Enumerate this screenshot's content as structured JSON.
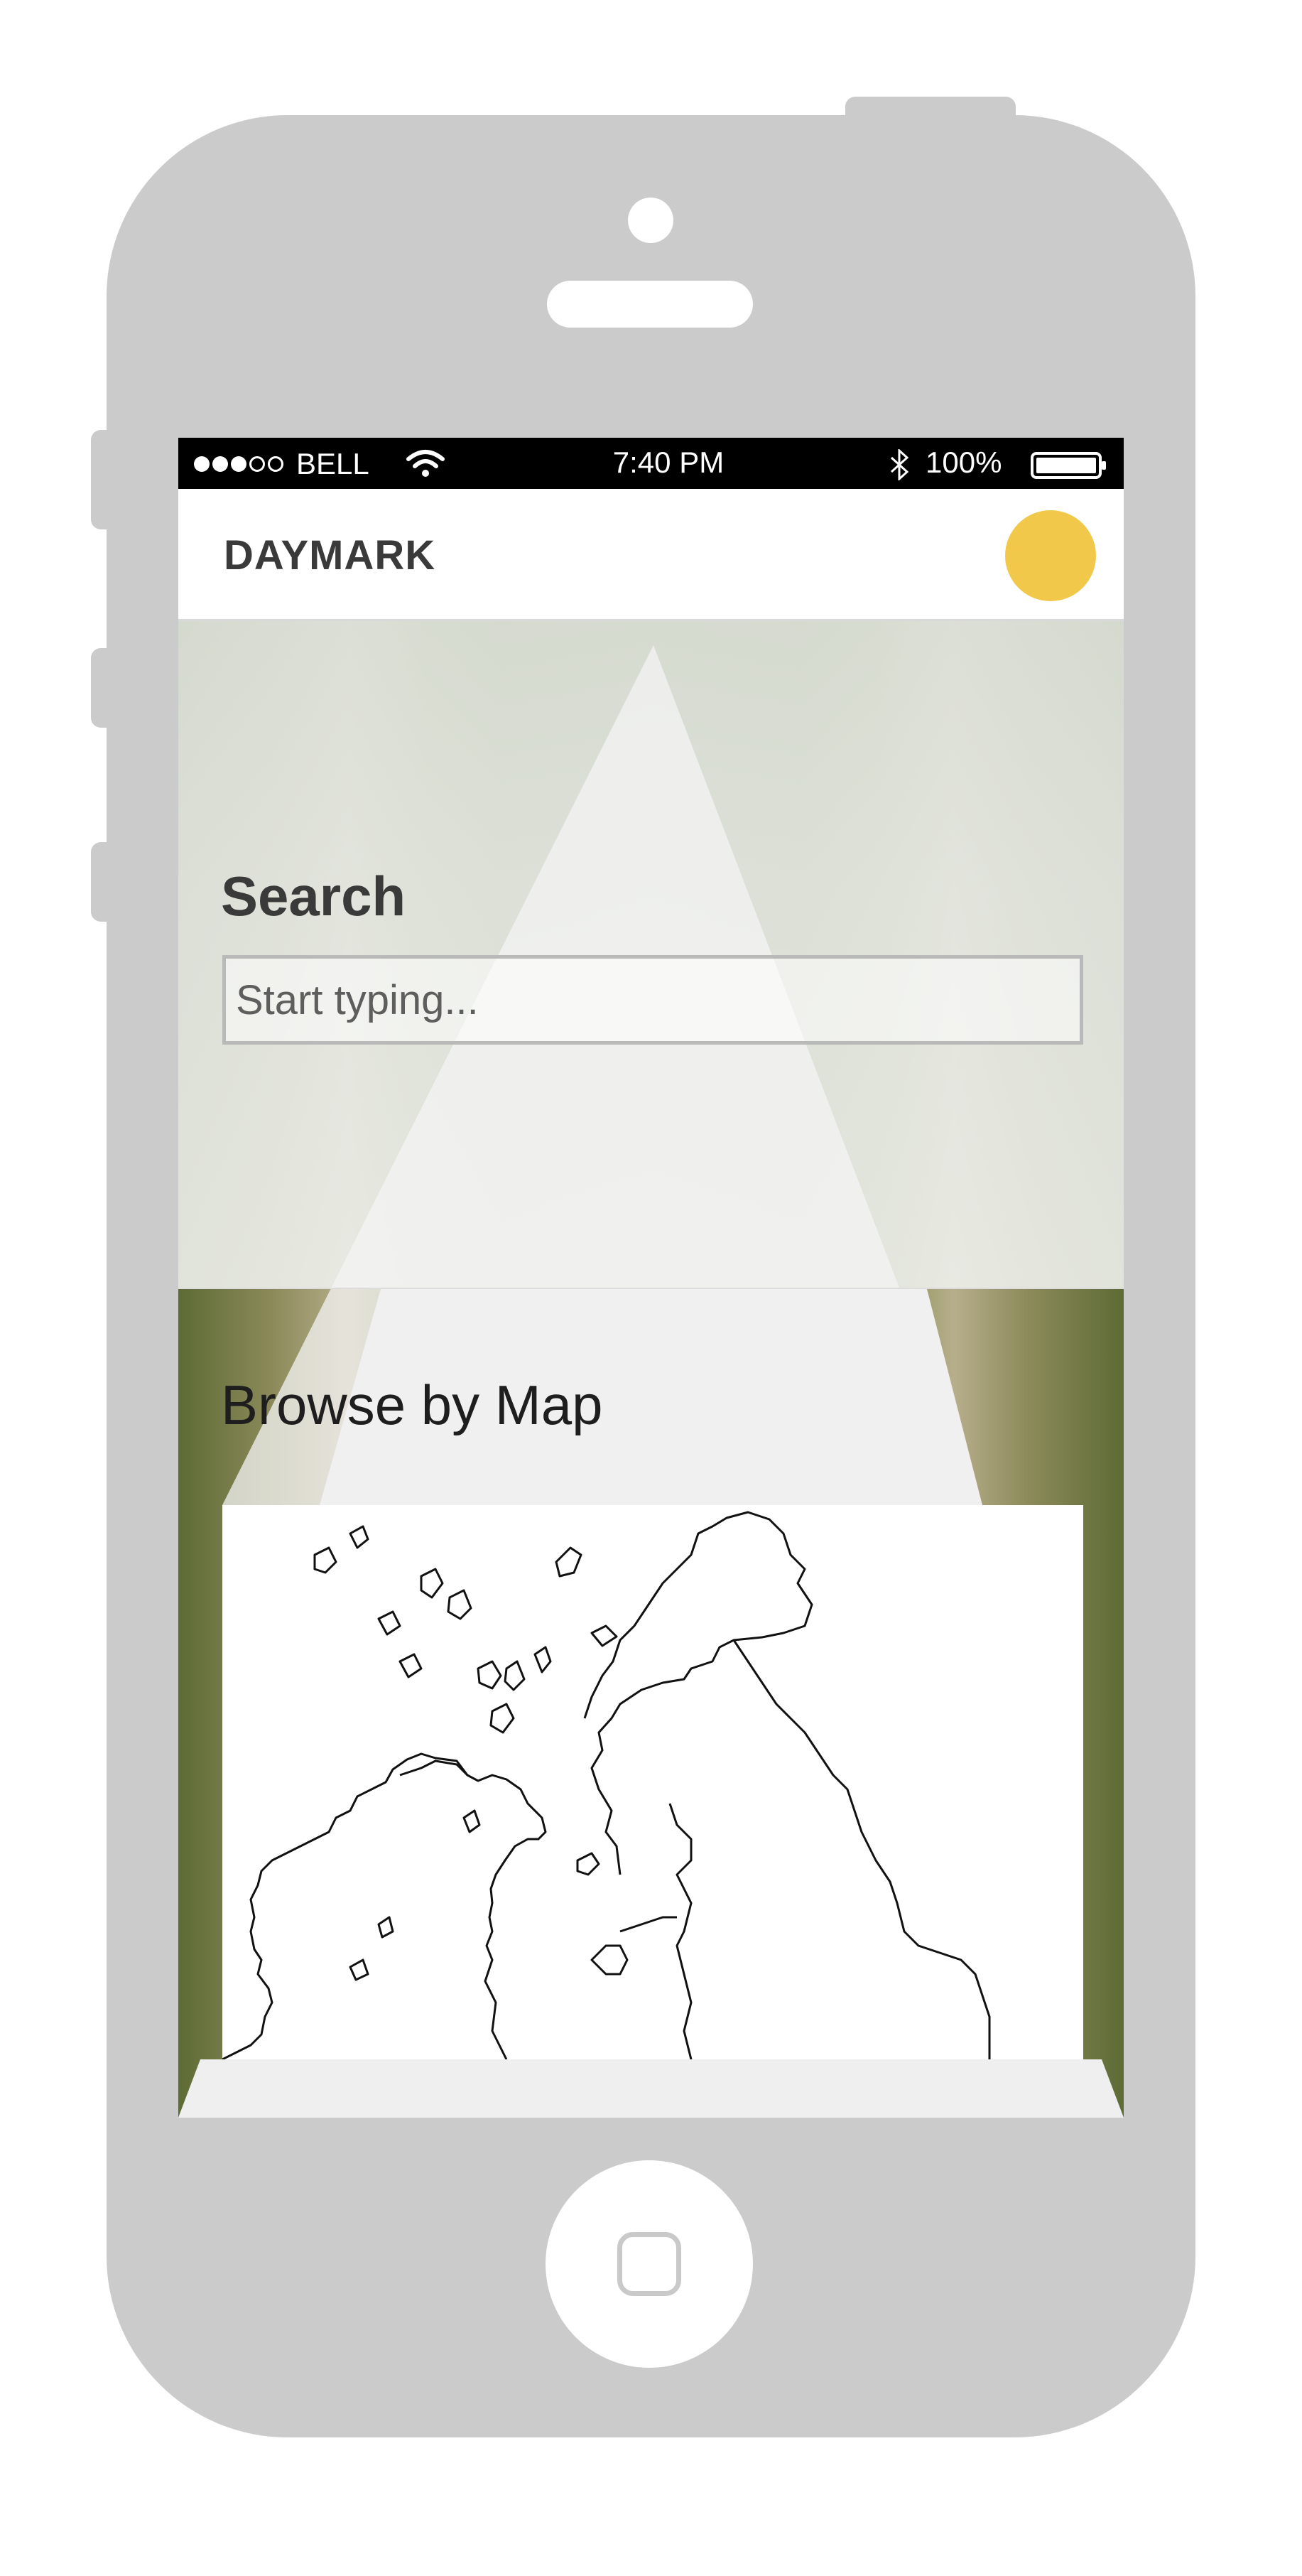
{
  "status_bar": {
    "carrier": "BELL",
    "time": "7:40 PM",
    "battery": "100%",
    "signal_strength": 3,
    "signal_max": 5
  },
  "header": {
    "title": "DAYMARK",
    "avatar_color": "#f2c84b"
  },
  "search": {
    "heading": "Search",
    "placeholder": "Start typing..."
  },
  "browse": {
    "heading": "Browse by Map"
  },
  "icons": {
    "wifi": "wifi-icon",
    "bluetooth": "bluetooth-icon",
    "battery": "battery-icon",
    "home": "home-button-icon"
  },
  "colors": {
    "phone_body": "#cbcbcb",
    "accent": "#f2c84b",
    "text_dark": "#3a3a3a"
  }
}
